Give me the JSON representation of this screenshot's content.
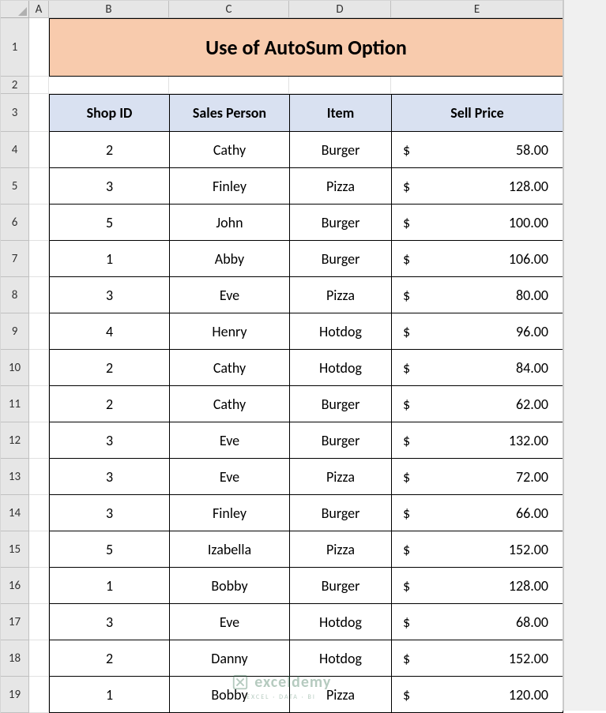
{
  "columns": {
    "A": "A",
    "B": "B",
    "C": "C",
    "D": "D",
    "E": "E"
  },
  "row_labels": [
    "1",
    "2",
    "3",
    "4",
    "5",
    "6",
    "7",
    "8",
    "9",
    "10",
    "11",
    "12",
    "13",
    "14",
    "15",
    "16",
    "17",
    "18",
    "19"
  ],
  "title": "Use of AutoSum Option",
  "headers": {
    "shop_id": "Shop ID",
    "sales_person": "Sales Person",
    "item": "Item",
    "sell_price": "Sell Price"
  },
  "currency_symbol": "$",
  "rows": [
    {
      "shop_id": "2",
      "sales_person": "Cathy",
      "item": "Burger",
      "sell_price": "58.00"
    },
    {
      "shop_id": "3",
      "sales_person": "Finley",
      "item": "Pizza",
      "sell_price": "128.00"
    },
    {
      "shop_id": "5",
      "sales_person": "John",
      "item": "Burger",
      "sell_price": "100.00"
    },
    {
      "shop_id": "1",
      "sales_person": "Abby",
      "item": "Burger",
      "sell_price": "106.00"
    },
    {
      "shop_id": "3",
      "sales_person": "Eve",
      "item": "Pizza",
      "sell_price": "80.00"
    },
    {
      "shop_id": "4",
      "sales_person": "Henry",
      "item": "Hotdog",
      "sell_price": "96.00"
    },
    {
      "shop_id": "2",
      "sales_person": "Cathy",
      "item": "Hotdog",
      "sell_price": "84.00"
    },
    {
      "shop_id": "2",
      "sales_person": "Cathy",
      "item": "Burger",
      "sell_price": "62.00"
    },
    {
      "shop_id": "3",
      "sales_person": "Eve",
      "item": "Burger",
      "sell_price": "132.00"
    },
    {
      "shop_id": "3",
      "sales_person": "Eve",
      "item": "Pizza",
      "sell_price": "72.00"
    },
    {
      "shop_id": "3",
      "sales_person": "Finley",
      "item": "Burger",
      "sell_price": "66.00"
    },
    {
      "shop_id": "5",
      "sales_person": "Izabella",
      "item": "Pizza",
      "sell_price": "152.00"
    },
    {
      "shop_id": "1",
      "sales_person": "Bobby",
      "item": "Burger",
      "sell_price": "128.00"
    },
    {
      "shop_id": "3",
      "sales_person": "Eve",
      "item": "Hotdog",
      "sell_price": "68.00"
    },
    {
      "shop_id": "2",
      "sales_person": "Danny",
      "item": "Hotdog",
      "sell_price": "152.00"
    },
    {
      "shop_id": "1",
      "sales_person": "Bobby",
      "item": "Pizza",
      "sell_price": "120.00"
    }
  ],
  "watermark": {
    "brand": "exceldemy",
    "tag": "EXCEL · DATA · BI"
  }
}
